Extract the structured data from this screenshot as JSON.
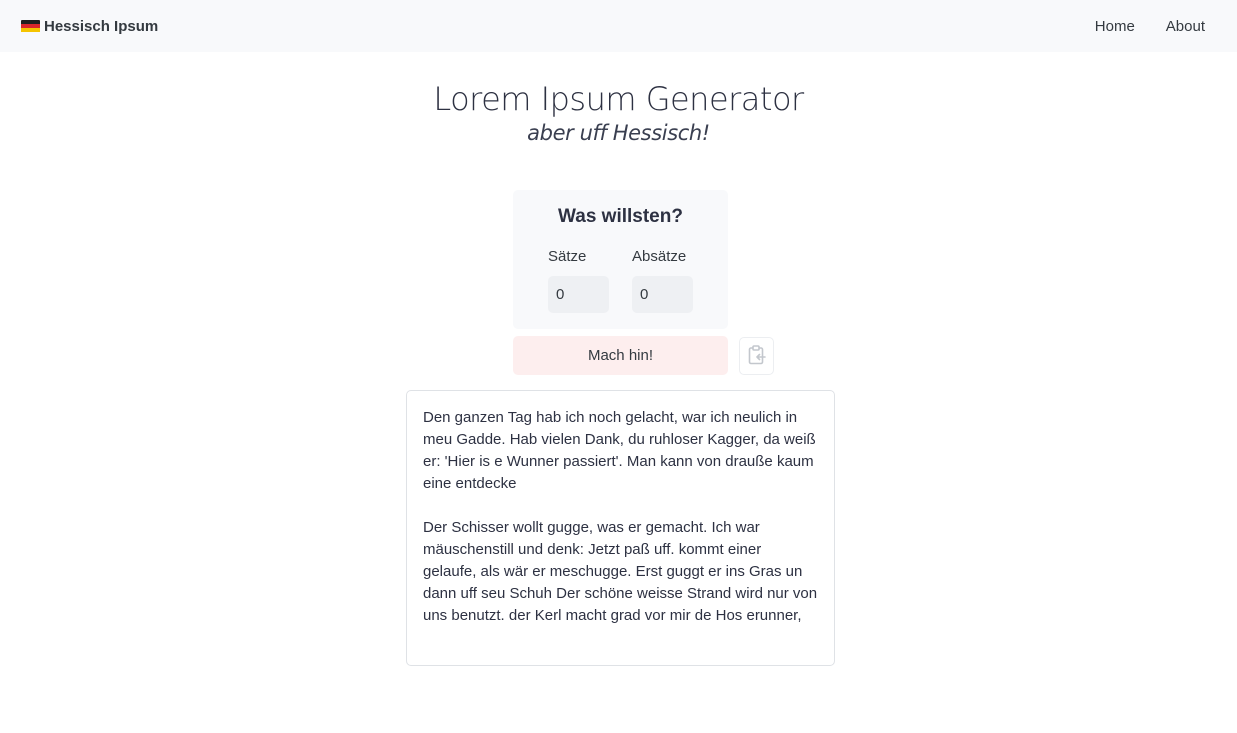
{
  "navbar": {
    "brand_label": "Hessisch Ipsum",
    "brand_icon": "german-flag-icon",
    "links": [
      {
        "label": "Home"
      },
      {
        "label": "About"
      }
    ]
  },
  "header": {
    "title": "Lorem Ipsum Generator",
    "subtitle": "aber uff Hessisch!"
  },
  "form": {
    "heading": "Was willsten?",
    "sentences_label": "Sätze",
    "sentences_value": "0",
    "paragraphs_label": "Absätze",
    "paragraphs_value": "0",
    "submit_label": "Mach hin!",
    "copy_icon": "clipboard-copy-icon"
  },
  "output": {
    "paragraphs": [
      "Den ganzen Tag hab ich noch gelacht, war ich neulich in meu Gadde. Hab vielen Dank, du ruhloser Kagger, da weiß er: 'Hier is e Wunner passiert'. Man kann von drauße kaum eine entdecke",
      "Der Schisser wollt gugge, was er gemacht. Ich war mäuschenstill und denk: Jetzt paß uff. kommt einer gelaufe, als wär er meschugge. Erst guggt er ins Gras un dann uff seu Schuh Der schöne weisse Strand wird nur von uns benutzt. der Kerl macht grad vor mir de Hos erunner,"
    ]
  },
  "colors": {
    "navbar_bg": "#f8f9fb",
    "card_bg": "#f8f9fb",
    "button_bg": "#fdeeee",
    "text": "#2d3142",
    "border": "#dfe2e6"
  }
}
